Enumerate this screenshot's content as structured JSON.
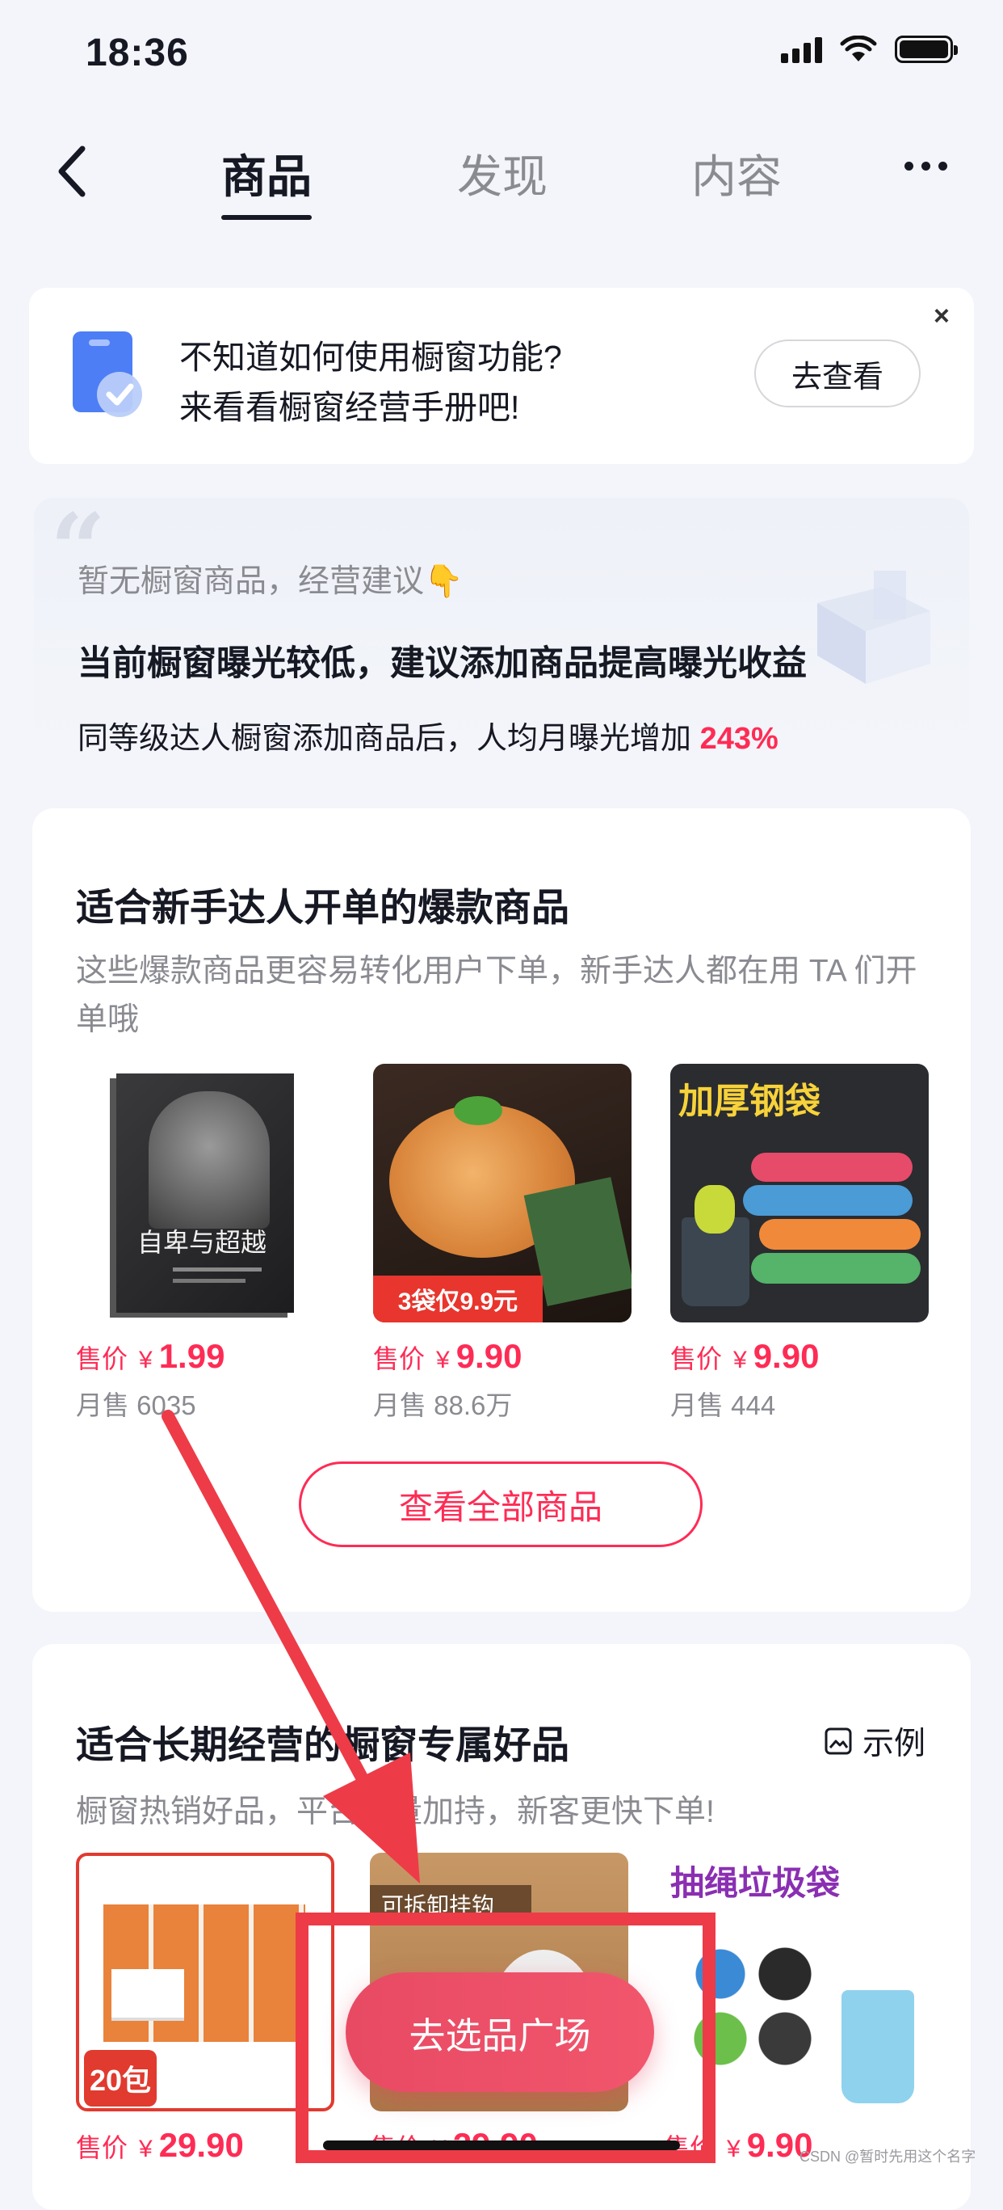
{
  "status_bar": {
    "time": "18:36"
  },
  "nav": {
    "tabs": [
      {
        "label": "商品",
        "active": true
      },
      {
        "label": "发现",
        "active": false
      },
      {
        "label": "内容",
        "active": false
      }
    ]
  },
  "guide": {
    "line1": "不知道如何使用橱窗功能?",
    "line2": "来看看橱窗经营手册吧!",
    "button": "去查看",
    "close": "×"
  },
  "advice": {
    "hint": "暂无橱窗商品，经营建议👇",
    "title": "当前橱窗曝光较低，建议添加商品提高曝光收益",
    "sub_prefix": "同等级达人橱窗添加商品后，人均月曝光增加 ",
    "sub_highlight": "243%"
  },
  "section1": {
    "title": "适合新手达人开单的爆款商品",
    "desc": "这些爆款商品更容易转化用户下单，新手达人都在用 TA 们开单哦",
    "products": [
      {
        "image": "book-cover",
        "cover_title": "自卑与超越",
        "price_label": "售价",
        "currency": "¥",
        "price": "1.99",
        "sales": "月售 6035"
      },
      {
        "image": "chicken-feet",
        "badge": "3袋仅9.9元",
        "price_label": "售价",
        "currency": "¥",
        "price": "9.90",
        "sales": "月售 88.6万"
      },
      {
        "image": "trash-bags",
        "badge": "加厚钢袋",
        "price_label": "售价",
        "currency": "¥",
        "price": "9.90",
        "sales": "月售 444"
      }
    ],
    "view_all": "查看全部商品"
  },
  "section2": {
    "title": "适合长期经营的橱窗专属好品",
    "desc": "橱窗热销好品，平台流量加持，新客更快下单!",
    "example_label": "示例",
    "products": [
      {
        "image": "tissue-boxes",
        "badge": "20包",
        "price_label": "售价",
        "currency": "¥",
        "price": "29.90"
      },
      {
        "image": "wall-hooks",
        "badge": "可拆卸挂钩",
        "price_label": "售价",
        "currency": "¥",
        "price": "29.90"
      },
      {
        "image": "drawstring-bags",
        "badge": "抽绳垃圾袋",
        "price_label": "售价",
        "currency": "¥",
        "price": "9.90"
      }
    ]
  },
  "fab": {
    "label": "去选品广场"
  },
  "watermark": "CSDN @暂时先用这个名字",
  "colors": {
    "accent": "#fe2c55",
    "fab": "#ec4d66",
    "highlight_box": "#ee3b48"
  }
}
